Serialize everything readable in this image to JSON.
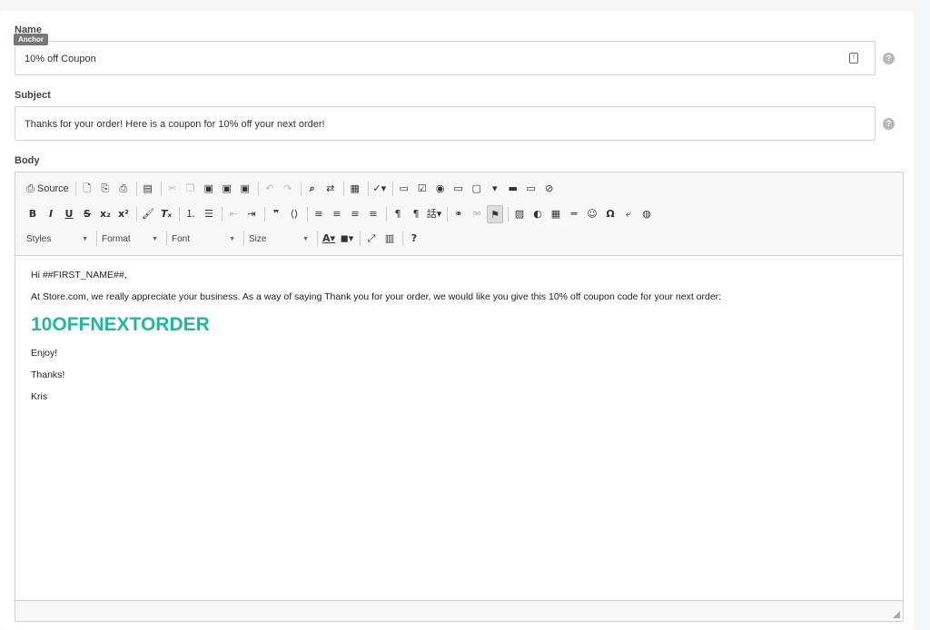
{
  "form": {
    "name_label": "Name",
    "name_value": "10% off Coupon",
    "tooltip": "Anchor",
    "subject_label": "Subject",
    "subject_value": "Thanks for your order! Here is a coupon for 10% off your next order!",
    "body_label": "Body",
    "help_glyph": "?"
  },
  "toolbar": {
    "source_label": "Source",
    "styles_label": "Styles",
    "format_label": "Format",
    "font_label": "Font",
    "size_label": "Size"
  },
  "body": {
    "greeting": "Hi ##FIRST_NAME##,",
    "message": "At Store.com, we really appreciate your business. As a way of saying Thank you for your order, we would like you give this 10% off coupon code for your next order:",
    "coupon_code": "10OFFNEXTORDER",
    "enjoy": "Enjoy!",
    "thanks": "Thanks!",
    "signature": "Kris"
  },
  "colors": {
    "coupon": "#1abc9c"
  }
}
